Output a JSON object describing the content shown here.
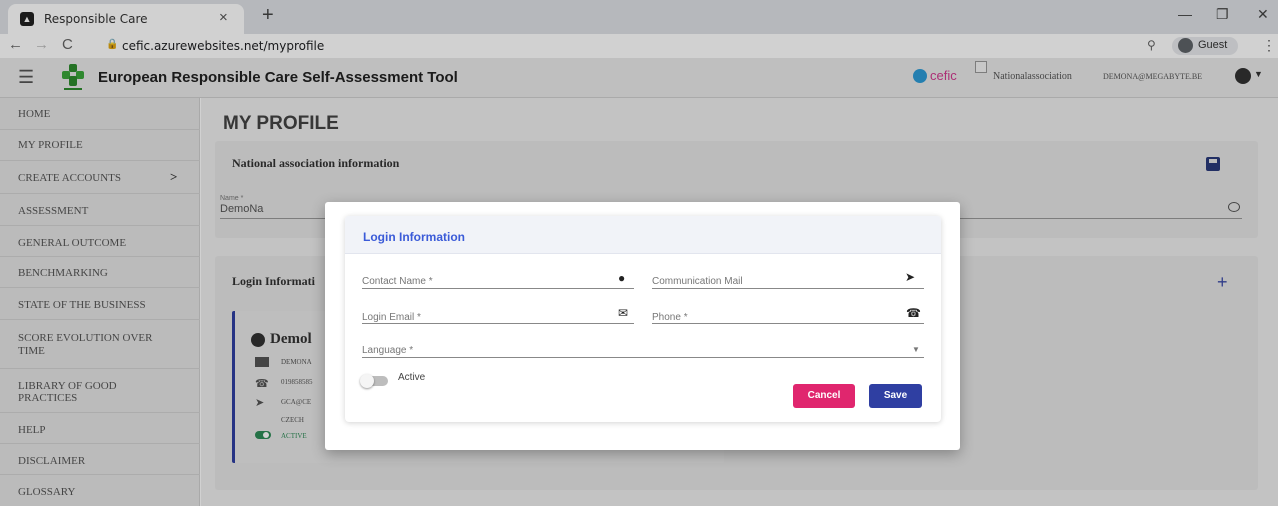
{
  "browser": {
    "tab_title": "Responsible Care",
    "tab_close": "×",
    "new_tab": "+",
    "url": "cefic.azurewebsites.net/myprofile",
    "profile_label": "Guest",
    "minimize": "—",
    "restore": "❐",
    "close": "✕",
    "menu": "⋮",
    "back": "←",
    "forward": "→",
    "reload": "C"
  },
  "header": {
    "title": "European Responsible Care Self-Assessment Tool",
    "cefic_label": "cefic",
    "association": "Nationalassociation",
    "user_email": "DEMONA@MEGABYTE.BE"
  },
  "sidebar": {
    "items": [
      {
        "label": "HOME"
      },
      {
        "label": "MY PROFILE"
      },
      {
        "label": "CREATE ACCOUNTS"
      },
      {
        "label": "ASSESSMENT"
      },
      {
        "label": "GENERAL OUTCOME"
      },
      {
        "label": "BENCHMARKING"
      },
      {
        "label": "STATE OF THE BUSINESS"
      },
      {
        "label": "SCORE EVOLUTION OVER TIME"
      },
      {
        "label": "LIBRARY OF GOOD PRACTICES"
      },
      {
        "label": "HELP"
      },
      {
        "label": "DISCLAIMER"
      },
      {
        "label": "GLOSSARY"
      }
    ]
  },
  "main": {
    "page_title": "MY PROFILE",
    "national_card": {
      "heading": "National association information",
      "name_label": "Name *",
      "name_value": "DemoNa"
    },
    "login_card": {
      "heading": "Login Informati",
      "contact": {
        "name": "Demol",
        "email": "DEMONA",
        "phone": "019858585",
        "comm_mail": "GCA@CE",
        "language": "CZECH",
        "status": "ACTIVE"
      }
    }
  },
  "modal": {
    "title": "Login Information",
    "contact_name_label": "Contact Name *",
    "communication_mail_label": "Communication Mail",
    "login_email_label": "Login Email *",
    "phone_label": "Phone *",
    "language_label": "Language *",
    "active_label": "Active",
    "active": false,
    "cancel_label": "Cancel",
    "save_label": "Save"
  },
  "colors": {
    "accent_blue": "#2f3fa2",
    "title_blue": "#3b5bd8",
    "cancel_pink": "#e0266e",
    "active_green": "#2e8b57"
  }
}
